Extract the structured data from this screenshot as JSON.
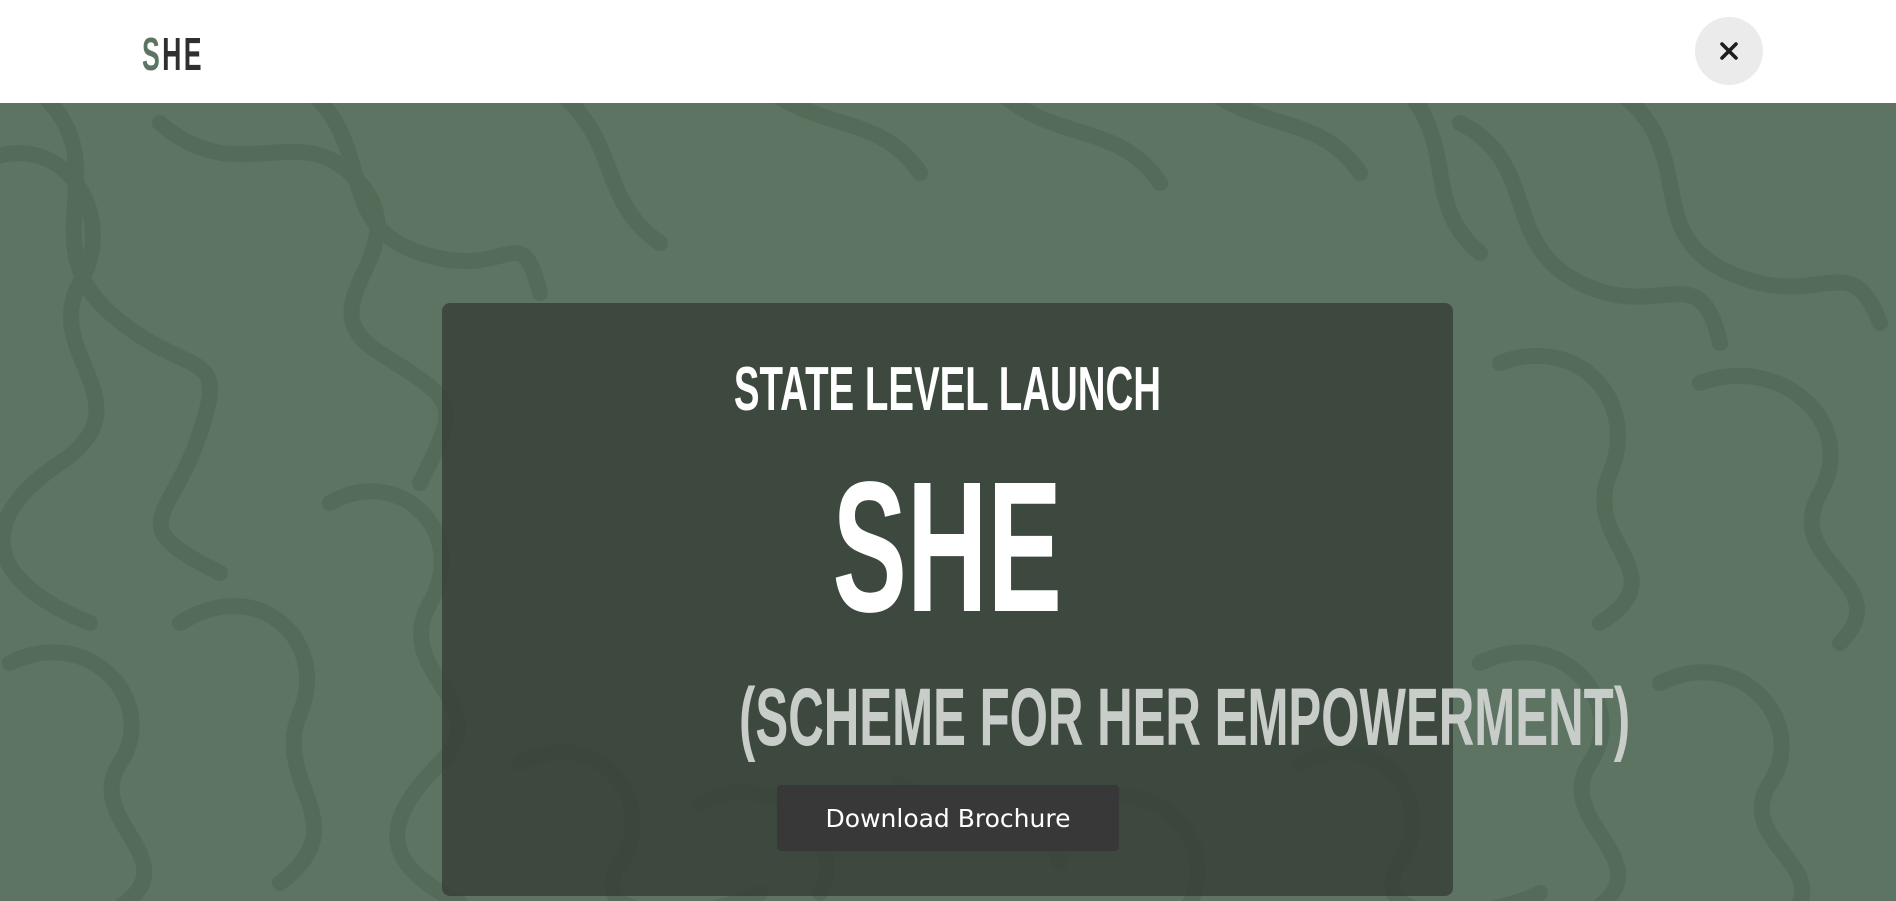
{
  "header": {
    "logo_first": "S",
    "logo_rest": "HE",
    "close_icon": "close-icon"
  },
  "hero": {
    "kicker": "STATE LEVEL LAUNCH",
    "title": "SHE",
    "subtitle": "(SCHEME FOR HER EMPOWERMENT)",
    "button_label": "Download Brochure"
  },
  "colors": {
    "brand_green": "#5c7461",
    "card_bg": "#3d4a40",
    "button_bg": "#383838",
    "subtitle_text": "#c9cdca"
  }
}
